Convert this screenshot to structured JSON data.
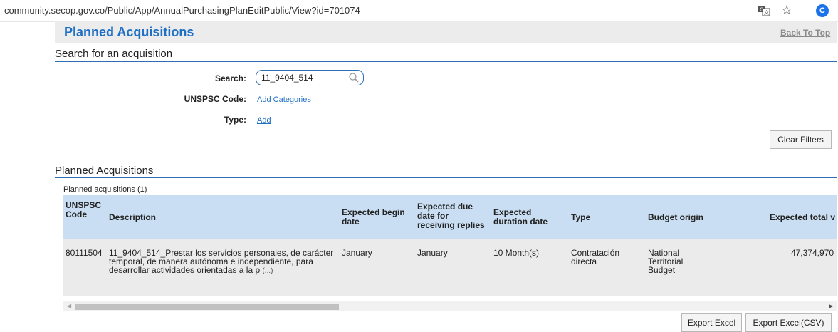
{
  "browser": {
    "url": "community.secop.gov.co/Public/App/AnnualPurchasingPlanEditPublic/View?id=701074",
    "avatar_letter": "C",
    "icons": [
      "translate-icon",
      "star-icon",
      "avatar"
    ]
  },
  "header": {
    "title": "Planned Acquisitions",
    "back_to_top": "Back To Top"
  },
  "search_section": {
    "title": "Search for an acquisition",
    "search_label": "Search:",
    "search_value": "11_9404_514",
    "unspsc_label": "UNSPSC Code:",
    "unspsc_link": "Add Categories",
    "type_label": "Type:",
    "type_link": "Add",
    "clear_filters": "Clear Filters"
  },
  "results_section": {
    "title": "Planned Acquisitions",
    "count_label": "Planned acquisitions (1)",
    "columns": {
      "unspsc": "UNSPSC Code",
      "description": "Description",
      "begin_date": "Expected begin date",
      "due_date": "Expected due date for receiving replies",
      "duration": "Expected duration date",
      "type": "Type",
      "budget_origin": "Budget origin",
      "total_value": "Expected total v"
    },
    "rows": [
      {
        "unspsc": "80111504",
        "description": "11_9404_514_Prestar los servicios personales, de carácter temporal, de manera autónoma e independiente, para desarrollar actividades orientadas a la p",
        "more": "(...)",
        "begin_date": "January",
        "due_date": "January",
        "duration": "10 Month(s)",
        "type": "Contratación directa",
        "budget_origin": "National Territorial Budget",
        "total_value": "47,374,970"
      }
    ]
  },
  "actions": {
    "export_excel": "Export Excel",
    "export_csv": "Export Excel(CSV)"
  },
  "colors": {
    "accent": "#1f6fc4",
    "header_row_bg": "#c9def3",
    "row_bg": "#ebebeb",
    "rule": "#2e6fb3"
  }
}
